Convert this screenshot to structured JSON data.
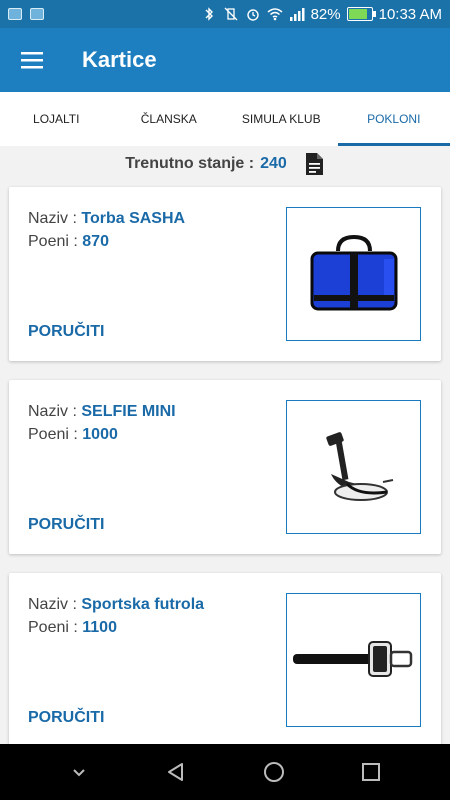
{
  "status_bar": {
    "battery": "82%",
    "battery_level": 0.82,
    "time": "10:33 AM"
  },
  "app_bar": {
    "title": "Kartice"
  },
  "tabs": [
    {
      "label": "LOJALTI",
      "active": false
    },
    {
      "label": "ČLANSKA",
      "active": false
    },
    {
      "label": "SIMULA KLUB",
      "active": false
    },
    {
      "label": "POKLONI",
      "active": true
    }
  ],
  "balance": {
    "label": "Trenutno stanje :",
    "value": "240"
  },
  "gifts": [
    {
      "name_label": "Naziv :",
      "name": "Torba SASHA",
      "points_label": "Poeni :",
      "points": "870",
      "order_label": "PORUČITI",
      "image": "bag-image"
    },
    {
      "name_label": "Naziv :",
      "name": "SELFIE MINI",
      "points_label": "Poeni :",
      "points": "1000",
      "order_label": "PORUČITI",
      "image": "selfie-stick-image"
    },
    {
      "name_label": "Naziv :",
      "name": "Sportska futrola",
      "points_label": "Poeni :",
      "points": "1100",
      "order_label": "PORUČITI",
      "image": "armband-image"
    }
  ],
  "colors": {
    "status_bar": "#1a72a8",
    "app_bar": "#1d7fc0",
    "accent": "#1a6aa8"
  }
}
